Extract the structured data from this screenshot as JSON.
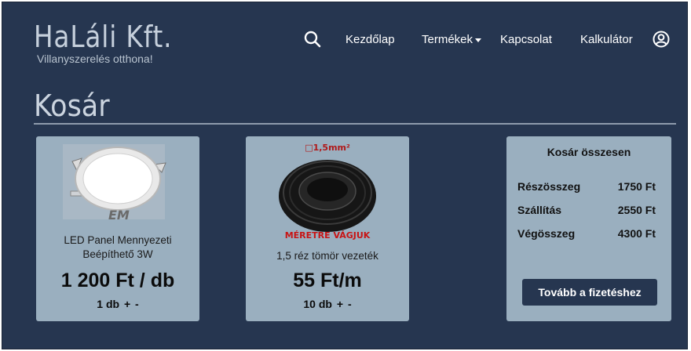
{
  "brand": {
    "name": "HaLáli Kft.",
    "tagline": "Villanyszerelés otthona!"
  },
  "nav": {
    "search_icon": "search-icon",
    "items": [
      {
        "label": "Kezdőlap"
      },
      {
        "label": "Termékek",
        "has_dropdown": true
      },
      {
        "label": "Kapcsolat"
      },
      {
        "label": "Kalkulátor"
      }
    ],
    "account_icon": "user-circle-icon"
  },
  "page": {
    "title": "Kosár"
  },
  "cart": {
    "items": [
      {
        "name": "LED Panel Mennyezeti Beépíthető 3W",
        "price": "1 200 Ft / db",
        "quantity": "1 db",
        "increment": "+",
        "decrement": "-",
        "image_text": "EM"
      },
      {
        "name": "1,5 réz tömör vezeték",
        "price": "55 Ft/m",
        "quantity": "10 db",
        "increment": "+",
        "decrement": "-",
        "image_top_text": "□1,5mm²",
        "image_bottom_text": "MÉRETRE VÁGJUK"
      }
    ]
  },
  "summary": {
    "title": "Kosár összesen",
    "rows": [
      {
        "label": "Részösszeg",
        "value": "1750 Ft"
      },
      {
        "label": "Szállítás",
        "value": "2550 Ft"
      },
      {
        "label": "Végösszeg",
        "value": "4300 Ft"
      }
    ],
    "checkout_label": "Tovább a fizetéshez"
  },
  "colors": {
    "background": "#263650",
    "card": "#9aafbf",
    "button": "#263650",
    "rule": "#8e9bac"
  }
}
